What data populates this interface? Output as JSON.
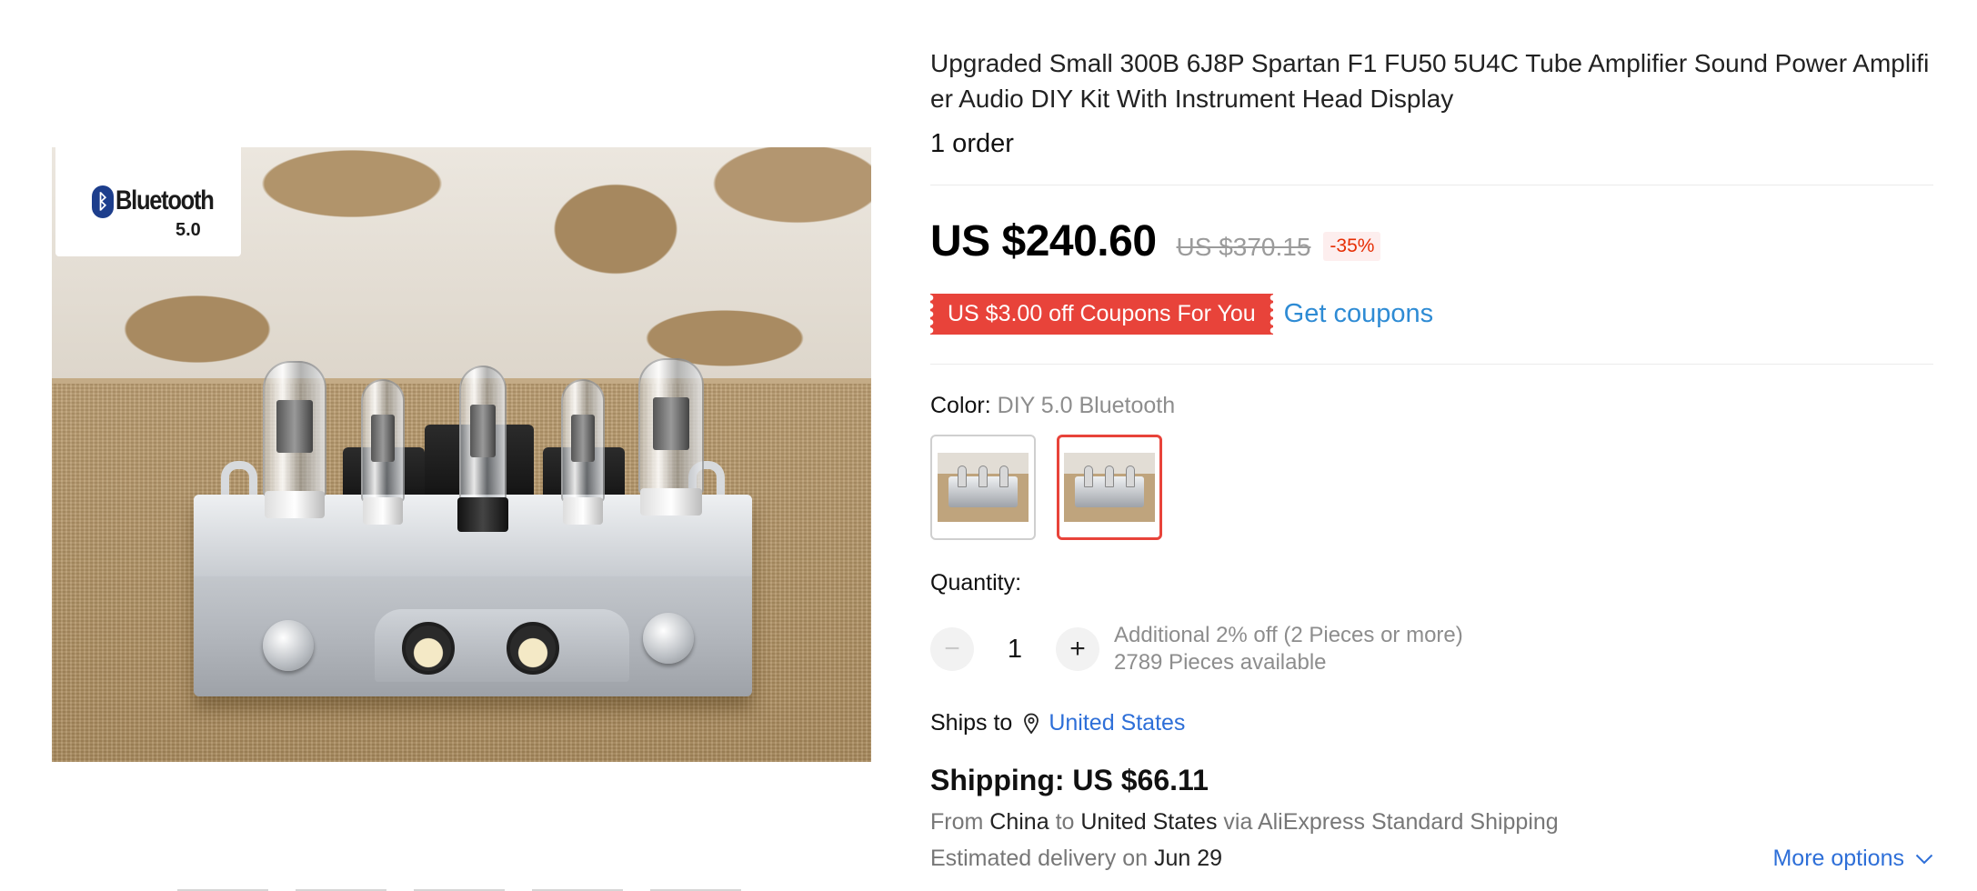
{
  "product": {
    "title": "Upgraded Small 300B 6J8P Spartan F1 FU50 5U4C Tube Amplifier Sound Power Amplifier Audio DIY Kit With Instrument Head Display",
    "orders": "1 order",
    "image_badge": {
      "brand": "Bluetooth",
      "version": "5.0"
    }
  },
  "price": {
    "current": "US $240.60",
    "original": "US $370.15",
    "discount": "-35%"
  },
  "coupon": {
    "label": "US $3.00 off Coupons For You",
    "link": "Get coupons"
  },
  "color": {
    "label": "Color:",
    "selected_value": "DIY 5.0 Bluetooth",
    "option_count": 2,
    "selected_index": 1
  },
  "quantity": {
    "label": "Quantity:",
    "value": "1",
    "minus_symbol": "−",
    "plus_symbol": "+",
    "promo": "Additional 2% off (2 Pieces or more)",
    "available": "2789 Pieces available"
  },
  "shipping": {
    "ships_to_label": "Ships to",
    "ships_to_country": "United States",
    "cost": "Shipping: US $66.11",
    "from_prefix": "From",
    "from_country": "China",
    "to_word": "to",
    "to_country": "United States",
    "via_text": "via AliExpress Standard Shipping",
    "delivery_prefix": "Estimated delivery on",
    "delivery_date": "Jun 29",
    "more_options": "More options"
  },
  "colors": {
    "accent_red": "#e8433a",
    "link_blue": "#2e6fd8",
    "coupon_blue": "#2e8bd4",
    "discount_red": "#e62e04"
  },
  "icons": {
    "location": "map-pin-icon",
    "chevron": "chevron-down-icon"
  }
}
